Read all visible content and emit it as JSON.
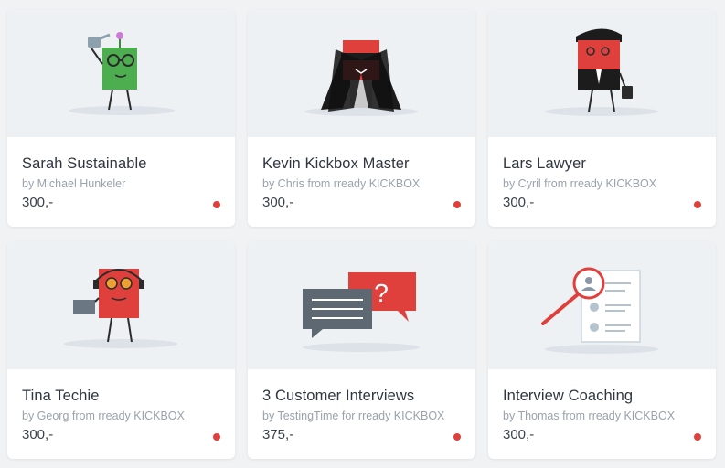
{
  "accent_color": "#e0403c",
  "cards": [
    {
      "title": "Sarah Sustainable",
      "author": "by Michael Hunkeler",
      "price": "300,-",
      "icon": "green-character-watering-can-icon"
    },
    {
      "title": "Kevin Kickbox Master",
      "author": "by Chris from rready KICKBOX",
      "price": "300,-",
      "icon": "red-character-cape-mask-icon"
    },
    {
      "title": "Lars Lawyer",
      "author": "by Cyril from rready KICKBOX",
      "price": "300,-",
      "icon": "red-character-suit-briefcase-icon"
    },
    {
      "title": "Tina Techie",
      "author": "by Georg from rready KICKBOX",
      "price": "300,-",
      "icon": "red-character-headset-laptop-icon"
    },
    {
      "title": "3 Customer Interviews",
      "author": "by TestingTime for rready KICKBOX",
      "price": "375,-",
      "icon": "speech-bubbles-icon"
    },
    {
      "title": "Interview Coaching",
      "author": "by Thomas from rready KICKBOX",
      "price": "300,-",
      "icon": "magnifier-profile-icon"
    }
  ]
}
